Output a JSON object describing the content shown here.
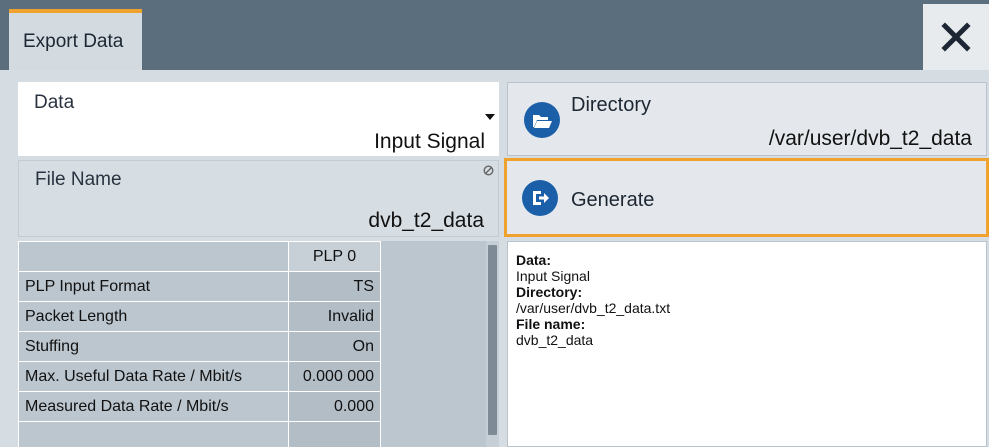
{
  "window": {
    "title": "Export Data"
  },
  "data_field": {
    "label": "Data",
    "value": "Input Signal"
  },
  "directory": {
    "label": "Directory",
    "value": "/var/user/dvb_t2_data"
  },
  "file_name": {
    "label": "File Name",
    "value": "dvb_t2_data"
  },
  "generate": {
    "label": "Generate"
  },
  "table": {
    "column_header": "PLP 0",
    "rows": [
      {
        "label": "PLP Input Format",
        "value": "TS"
      },
      {
        "label": "Packet Length",
        "value": "Invalid"
      },
      {
        "label": "Stuffing",
        "value": "On"
      },
      {
        "label": "Max. Useful Data Rate / Mbit/s",
        "value": "0.000 000"
      },
      {
        "label": "Measured Data Rate / Mbit/s",
        "value": "0.000"
      }
    ]
  },
  "summary": {
    "data_key": "Data:",
    "data_val": "Input Signal",
    "dir_key": "Directory:",
    "dir_val": "/var/user/dvb_t2_data.txt",
    "file_key": "File name:",
    "file_val": "dvb_t2_data"
  },
  "icons": {
    "close": "close-icon",
    "directory": "folder-open-icon",
    "generate": "export-icon",
    "dropdown": "dropdown-arrow-icon",
    "edit_disabled": "disabled-edit-icon"
  },
  "colors": {
    "accent": "#f0a22e",
    "titlebar": "#5a6e7e",
    "button_icon": "#1b5fa8"
  }
}
